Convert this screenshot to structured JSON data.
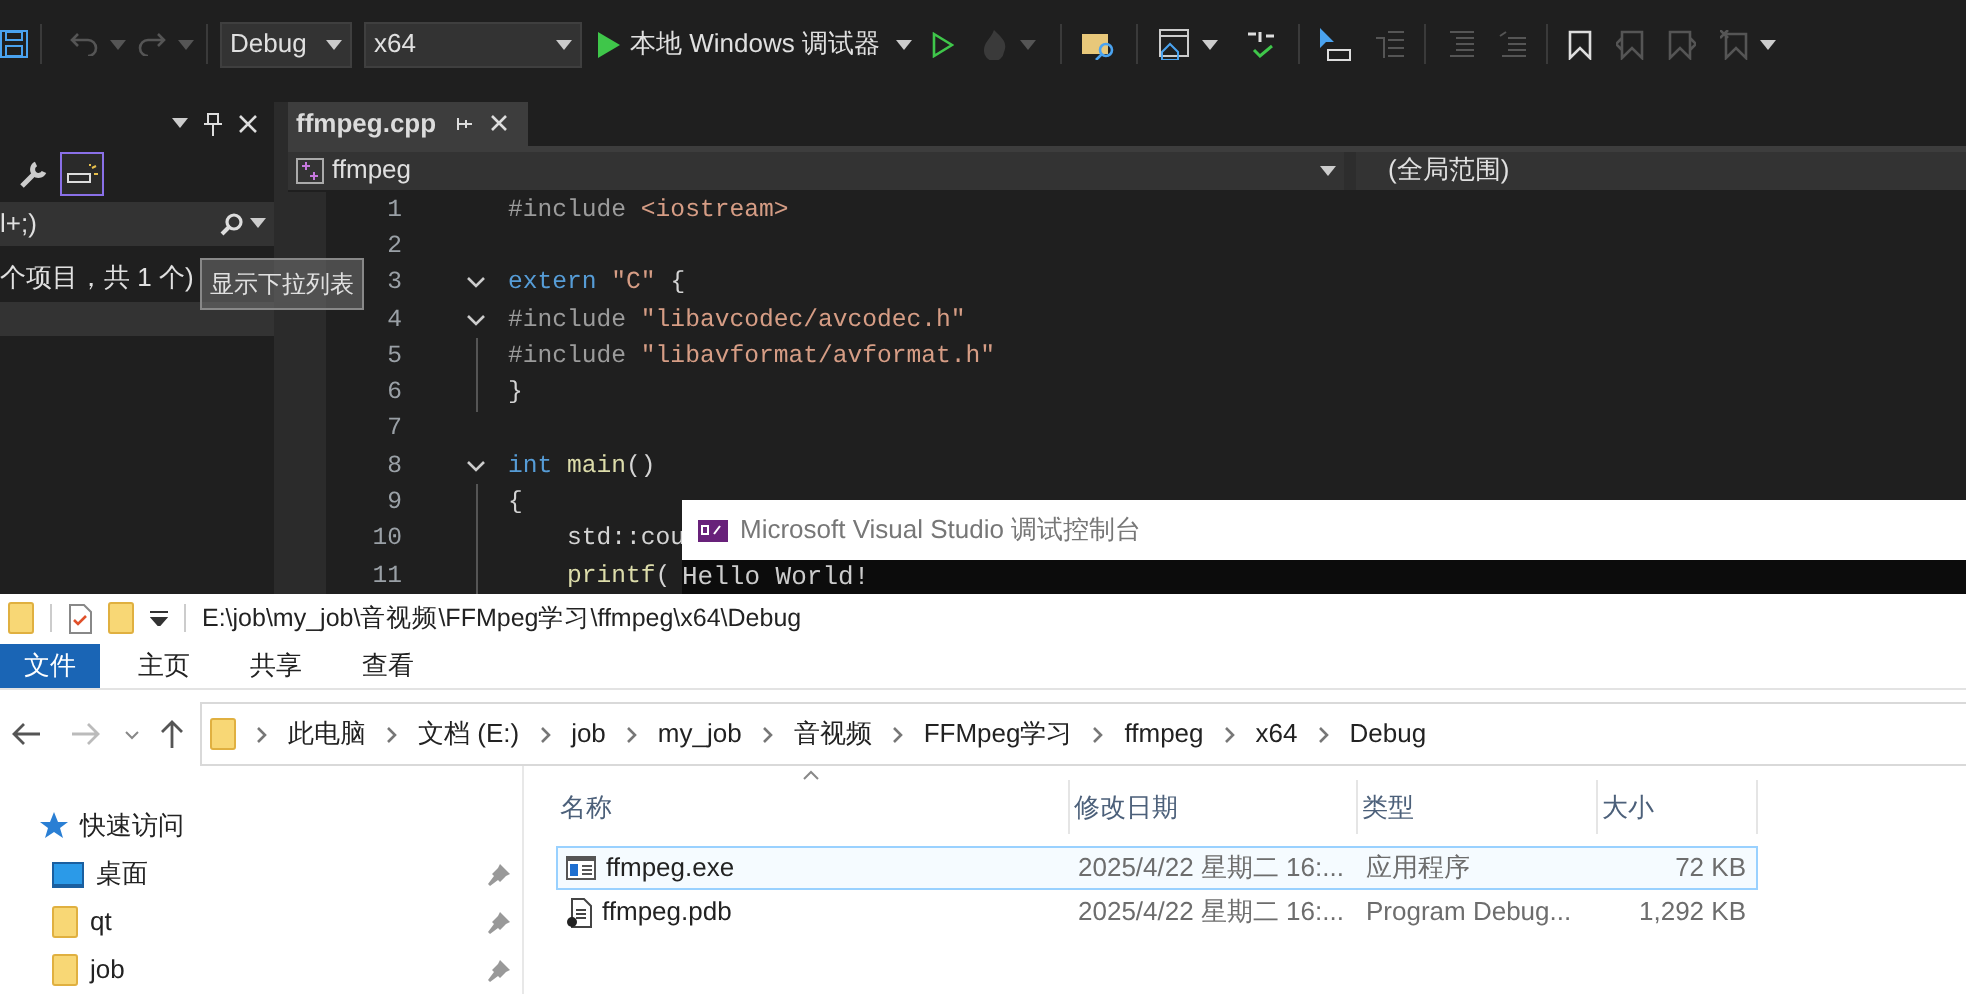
{
  "toolbar": {
    "configuration": "Debug",
    "platform": "x64",
    "debugger": "本地 Windows 调试器"
  },
  "side_panel": {
    "tools": [
      {
        "kind": "wrench",
        "selected": false
      },
      {
        "kind": "view",
        "selected": true
      }
    ],
    "search": "l+;)",
    "summary": "个项目，共 1 个)"
  },
  "tooltip": "显示下拉列表",
  "editor": {
    "tab": "ffmpeg.cpp",
    "project": "ffmpeg",
    "scope": "(全局范围)",
    "lines": [
      {
        "number": "1",
        "fold": false,
        "guide": false,
        "tokens": [
          {
            "text": "#include",
            "kind": "directive"
          },
          {
            "text": " <iostream>",
            "kind": "string"
          }
        ]
      },
      {
        "number": "2",
        "fold": false,
        "guide": false
      },
      {
        "number": "3",
        "fold": true,
        "guide": false,
        "tokens": [
          {
            "text": "extern",
            "kind": "keyword"
          },
          {
            "text": " \"C\"",
            "kind": "string"
          },
          {
            "text": " {",
            "kind": "plain"
          }
        ]
      },
      {
        "number": "4",
        "fold": true,
        "guide": false,
        "tokens": [
          {
            "text": "#include",
            "kind": "directive"
          },
          {
            "text": " \"libavcodec/avcodec.h\"",
            "kind": "string"
          }
        ]
      },
      {
        "number": "5",
        "fold": false,
        "guide": true,
        "tokens": [
          {
            "text": "#include",
            "kind": "directive"
          },
          {
            "text": " \"libavformat/avformat.h\"",
            "kind": "string"
          }
        ]
      },
      {
        "number": "6",
        "fold": false,
        "guide": true,
        "tokens": [
          {
            "text": "}",
            "kind": "plain"
          }
        ]
      },
      {
        "number": "7",
        "fold": false,
        "guide": false
      },
      {
        "number": "8",
        "fold": true,
        "guide": false,
        "tokens": [
          {
            "text": "int",
            "kind": "keyword"
          },
          {
            "text": " main",
            "kind": "function"
          },
          {
            "text": "()",
            "kind": "plain"
          }
        ]
      },
      {
        "number": "9",
        "fold": false,
        "guide": true,
        "tokens": [
          {
            "text": "{",
            "kind": "plain"
          }
        ]
      },
      {
        "number": "10",
        "fold": false,
        "guide": true,
        "tokens": [
          {
            "text": "    std::cou",
            "kind": "plain"
          }
        ]
      },
      {
        "number": "11",
        "fold": false,
        "guide": true,
        "tokens": [
          {
            "text": "    printf",
            "kind": "function"
          },
          {
            "text": "(",
            "kind": "plain"
          }
        ]
      }
    ]
  },
  "console": {
    "title": "Microsoft Visual Studio 调试控制台",
    "output": "Hello World!"
  },
  "explorer": {
    "path": "E:\\job\\my_job\\音视频\\FFMpeg学习\\ffmpeg\\x64\\Debug",
    "ribbon_tabs": [
      {
        "label": "文件",
        "selected": true
      },
      {
        "label": "主页",
        "selected": false
      },
      {
        "label": "共享",
        "selected": false
      },
      {
        "label": "查看",
        "selected": false
      }
    ],
    "breadcrumbs": [
      "此电脑",
      "文档 (E:)",
      "job",
      "my_job",
      "音视频",
      "FFMpeg学习",
      "ffmpeg",
      "x64",
      "Debug"
    ],
    "nav_items": [
      {
        "label": "快速访问",
        "kind": "star",
        "pinned": false
      },
      {
        "label": "桌面",
        "kind": "desktop",
        "pinned": true
      },
      {
        "label": "qt",
        "kind": "folder",
        "pinned": true
      },
      {
        "label": "job",
        "kind": "folder",
        "pinned": true
      }
    ],
    "columns": [
      "名称",
      "修改日期",
      "类型",
      "大小"
    ],
    "files": [
      {
        "name": "ffmpeg.exe",
        "kind": "exe",
        "modified": "2025/4/22 星期二 16:...",
        "type": "应用程序",
        "size": "72 KB",
        "selected": true
      },
      {
        "name": "ffmpeg.pdb",
        "kind": "pdb",
        "modified": "2025/4/22 星期二 16:...",
        "type": "Program Debug...",
        "size": "1,292 KB",
        "selected": false
      }
    ]
  }
}
